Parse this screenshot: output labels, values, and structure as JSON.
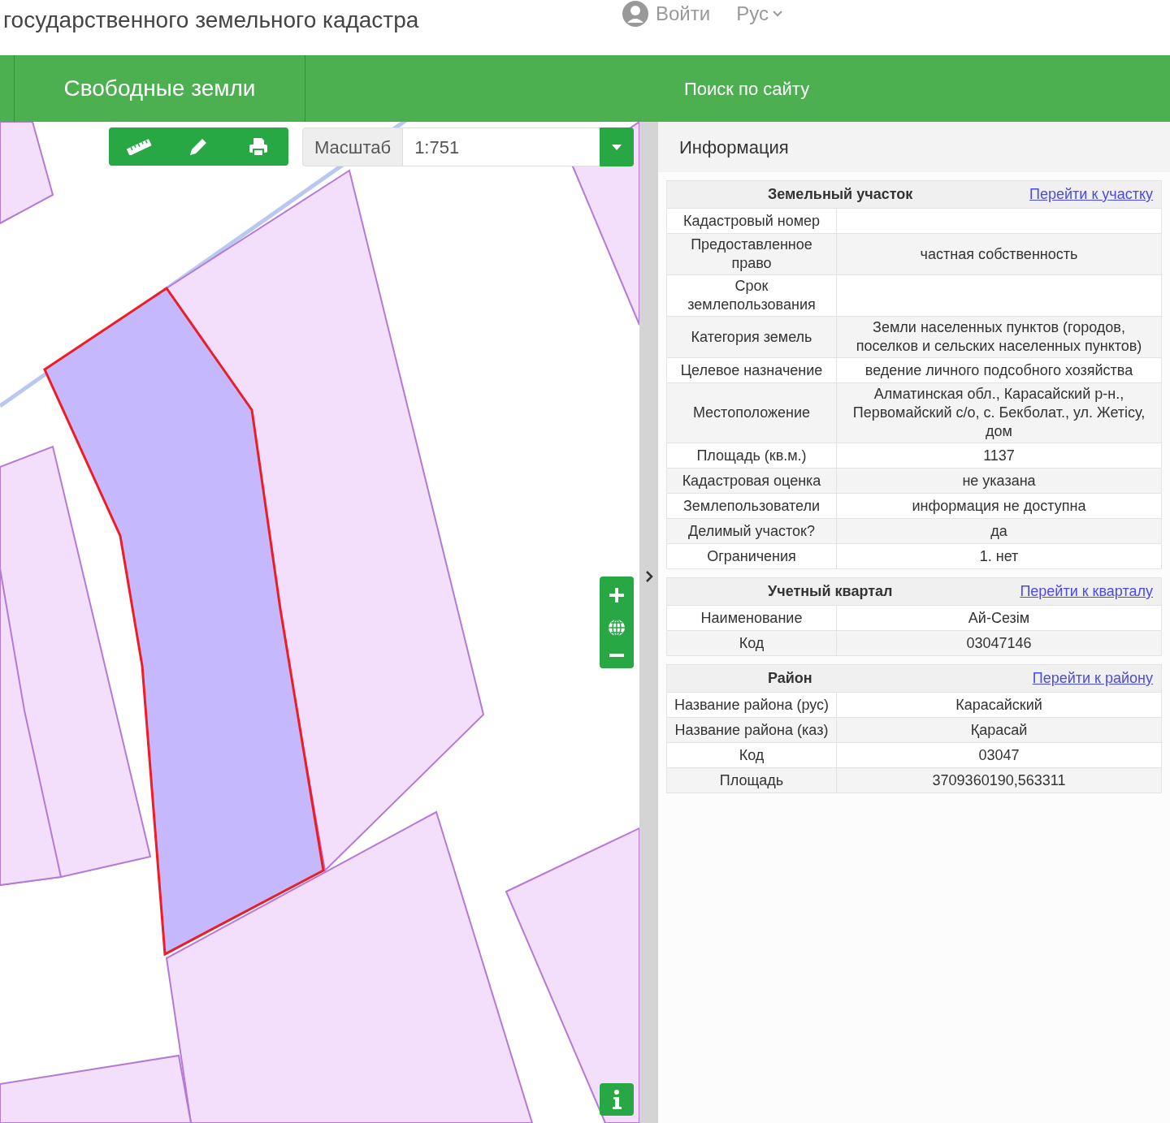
{
  "header": {
    "subtitle": "государственного земельного кадастра",
    "login": "Войти",
    "language": "Рус"
  },
  "nav": {
    "title": "Свободные земли",
    "search": "Поиск по сайту"
  },
  "map_toolbar": {
    "scale_label": "Масштаб",
    "scale_value": "1:751"
  },
  "info_panel": {
    "title": "Информация",
    "sections": [
      {
        "title": "Земельный участок",
        "link": "Перейти к участку",
        "rows": [
          {
            "label": "Кадастровый номер",
            "value": ""
          },
          {
            "label": "Предоставленное право",
            "value": "частная собственность"
          },
          {
            "label": "Срок землепользования",
            "value": ""
          },
          {
            "label": "Категория земель",
            "value": "Земли населенных пунктов (городов, поселков и сельских населенных пунктов)"
          },
          {
            "label": "Целевое назначение",
            "value": "ведение личного подсобного хозяйства"
          },
          {
            "label": "Местоположение",
            "value": "Алматинская обл., Карасайский р-н., Первомайский с/о, с. Бекболат., ул. Жетісу, дом"
          },
          {
            "label": "Площадь (кв.м.)",
            "value": "1137"
          },
          {
            "label": "Кадастровая оценка",
            "value": "не указана"
          },
          {
            "label": "Землепользователи",
            "value": "информация не доступна"
          },
          {
            "label": "Делимый участок?",
            "value": "да"
          },
          {
            "label": "Ограничения",
            "value": "1. нет"
          }
        ]
      },
      {
        "title": "Учетный квартал",
        "link": "Перейти к кварталу",
        "rows": [
          {
            "label": "Наименование",
            "value": "Ай-Сезім"
          },
          {
            "label": "Код",
            "value": "03047146"
          }
        ]
      },
      {
        "title": "Район",
        "link": "Перейти к району",
        "rows": [
          {
            "label": "Название района (рус)",
            "value": "Карасайский"
          },
          {
            "label": "Название района (каз)",
            "value": "Қарасай"
          },
          {
            "label": "Код",
            "value": "03047"
          },
          {
            "label": "Площадь",
            "value": "3709360190,563311"
          }
        ]
      }
    ]
  }
}
